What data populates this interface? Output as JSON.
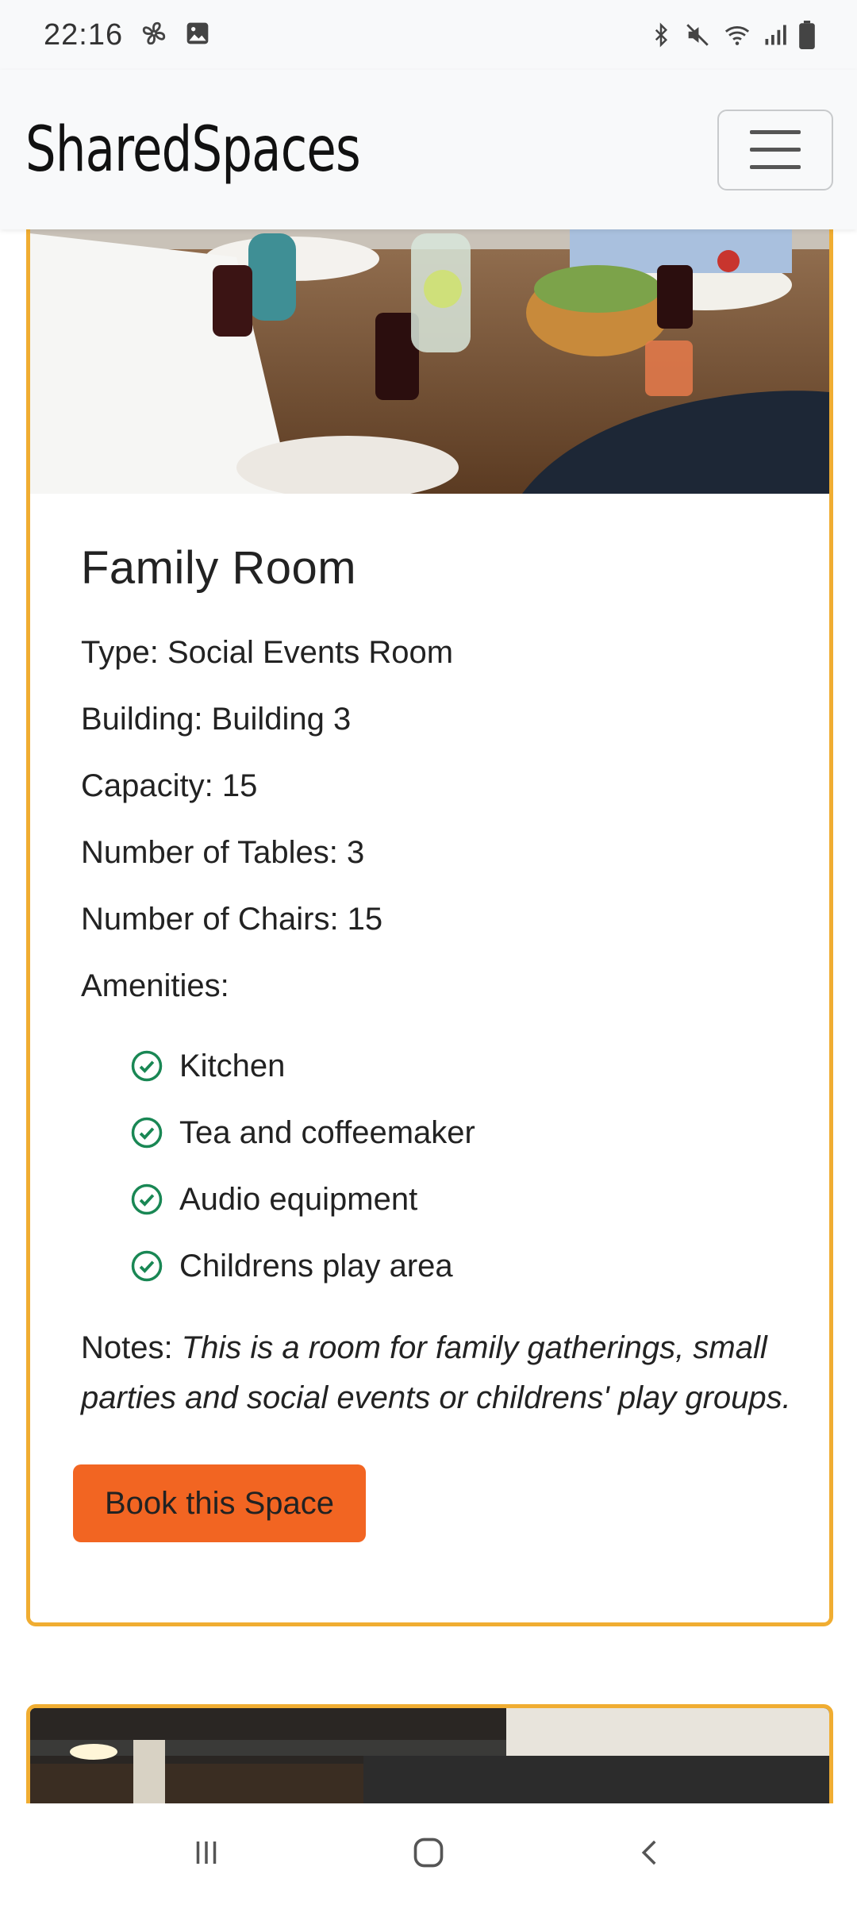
{
  "status_bar": {
    "time": "22:16",
    "left_icons": [
      "fan-icon",
      "image-icon"
    ],
    "right_icons": [
      "bluetooth-icon",
      "mute-icon",
      "wifi-icon",
      "signal-icon",
      "battery-icon"
    ]
  },
  "navbar": {
    "brand": "SharedSpaces",
    "toggle_icon": "hamburger-icon"
  },
  "room": {
    "name": "Family Room",
    "type": "Type: Social Events Room",
    "building": "Building: Building 3",
    "capacity": "Capacity: 15",
    "tables": "Number of Tables: 3",
    "chairs": "Number of Chairs: 15",
    "amenities_label": "Amenities:",
    "amenities": [
      "Kitchen",
      "Tea and coffeemaker",
      "Audio equipment",
      "Childrens play area"
    ],
    "notes_label": "Notes:",
    "notes_text": "This is a room for family gatherings, small parties and social events or childrens' play groups.",
    "button_label": "Book this Space"
  },
  "colors": {
    "card_border": "#f0ad32",
    "button_bg": "#f26522",
    "check_icon": "#198754"
  },
  "system_nav": [
    "recents-icon",
    "home-icon",
    "back-icon"
  ]
}
